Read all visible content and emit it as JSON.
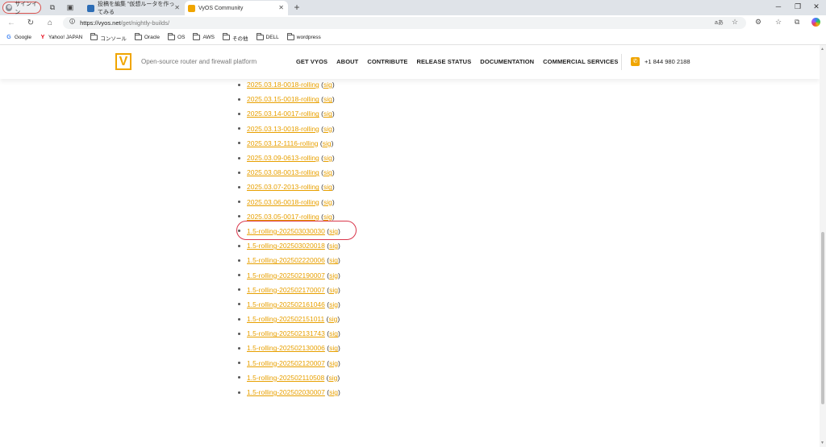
{
  "browser": {
    "profile_label": "サインイン",
    "tabs": [
      {
        "title": "投稿を編集 \"仮想ルータを作ってみる",
        "active": false
      },
      {
        "title": "VyOS Community",
        "active": true
      }
    ],
    "new_tab": "+",
    "url_host": "https://vyos.net",
    "url_path": "/get/nightly-builds/",
    "read_aloud_label": "aあ"
  },
  "bookmarks": [
    {
      "label": "Google",
      "icon": "google-icon"
    },
    {
      "label": "Yahoo! JAPAN",
      "icon": "yahoo-icon"
    },
    {
      "label": "コンソール",
      "icon": "folder-icon"
    },
    {
      "label": "Oracle",
      "icon": "folder-icon"
    },
    {
      "label": "OS",
      "icon": "folder-icon"
    },
    {
      "label": "AWS",
      "icon": "folder-icon"
    },
    {
      "label": "その他",
      "icon": "folder-icon"
    },
    {
      "label": "DELL",
      "icon": "folder-icon"
    },
    {
      "label": "wordpress",
      "icon": "folder-icon"
    }
  ],
  "site": {
    "logo_letter": "V",
    "tagline": "Open-source router and firewall platform",
    "nav": [
      "GET VYOS",
      "ABOUT",
      "CONTRIBUTE",
      "RELEASE STATUS",
      "DOCUMENTATION",
      "COMMERCIAL SERVICES"
    ],
    "phone": "+1 844 980 2188",
    "accent_color": "#f0a500"
  },
  "builds": [
    "2025.03.18-0018-rolling",
    "2025.03.15-0018-rolling",
    "2025.03.14-0017-rolling",
    "2025.03.13-0018-rolling",
    "2025.03.12-1116-rolling",
    "2025.03.09-0613-rolling",
    "2025.03.08-0013-rolling",
    "2025.03.07-2013-rolling",
    "2025.03.06-0018-rolling",
    "2025.03.05-0017-rolling",
    "1.5-rolling-202503030030",
    "1.5-rolling-202503020018",
    "1.5-rolling-202502220006",
    "1.5-rolling-202502190007",
    "1.5-rolling-202502170007",
    "1.5-rolling-202502161046",
    "1.5-rolling-202502151011",
    "1.5-rolling-202502131743",
    "1.5-rolling-202502130006",
    "1.5-rolling-202502120007",
    "1.5-rolling-202502110508",
    "1.5-rolling-202502030007"
  ],
  "sig_label": "sig",
  "highlighted_build": "1.5-rolling-202503030030"
}
